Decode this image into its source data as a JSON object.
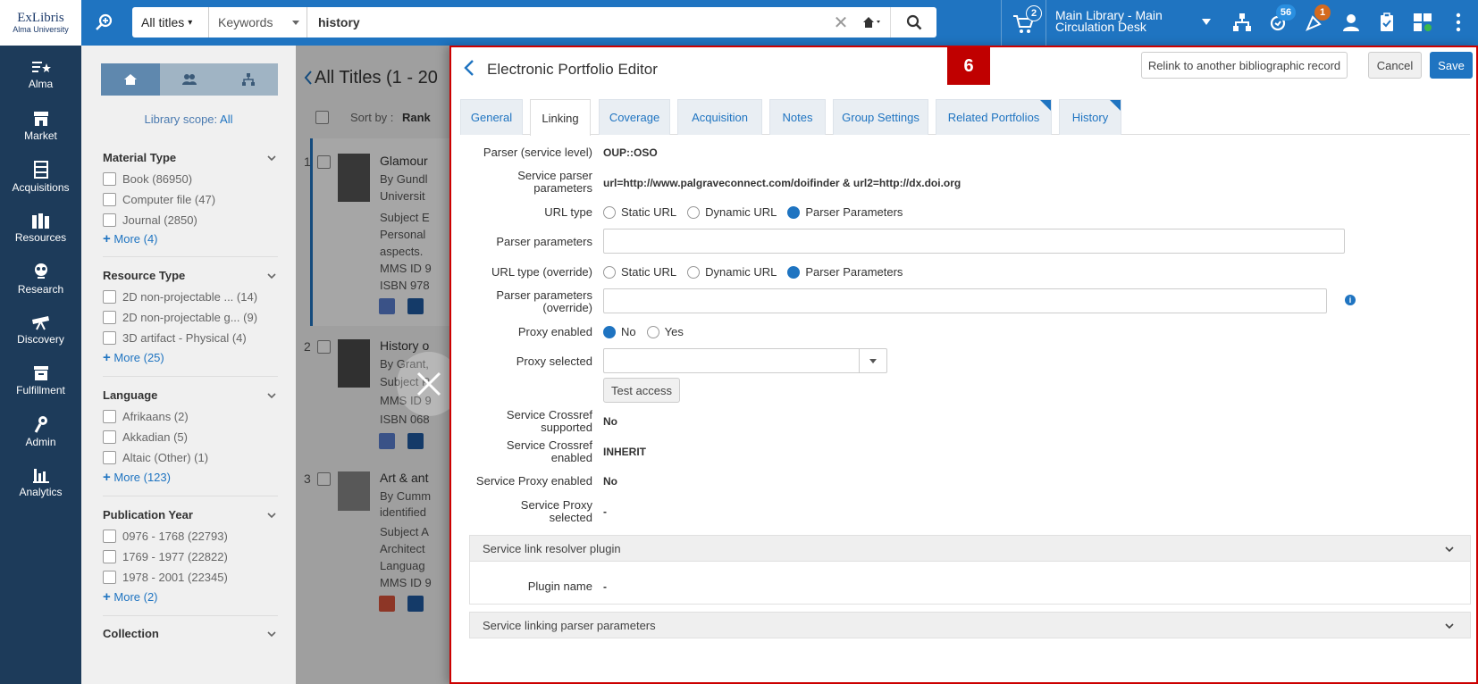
{
  "topbar": {
    "logo_main": "ExLibris",
    "logo_sub": "Alma University",
    "search_scope": "All titles",
    "search_field": "Keywords",
    "search_query": "history",
    "library": "Main Library - Main Circulation Desk",
    "library_line1": "Main Library - Main",
    "library_line2": "Circulation Desk",
    "cart_count": "2",
    "tasks_count": "56",
    "alerts_count": "1"
  },
  "nav": [
    {
      "label": "Alma",
      "icon": "alma-star-icon"
    },
    {
      "label": "Market",
      "icon": "market-icon"
    },
    {
      "label": "Acquisitions",
      "icon": "acquisitions-icon"
    },
    {
      "label": "Resources",
      "icon": "resources-icon"
    },
    {
      "label": "Research",
      "icon": "research-icon"
    },
    {
      "label": "Discovery",
      "icon": "discovery-icon"
    },
    {
      "label": "Fulfillment",
      "icon": "fulfillment-icon"
    },
    {
      "label": "Admin",
      "icon": "admin-icon"
    },
    {
      "label": "Analytics",
      "icon": "analytics-icon"
    }
  ],
  "facets": {
    "scope_label": "Library scope:",
    "scope_value": "All",
    "groups": [
      {
        "title": "Material Type",
        "items": [
          "Book (86950)",
          "Computer file (47)",
          "Journal (2850)"
        ],
        "more": "More (4)"
      },
      {
        "title": "Resource Type",
        "items": [
          "2D non-projectable ... (14)",
          "2D non-projectable g... (9)",
          "3D artifact - Physical (4)"
        ],
        "more": "More (25)"
      },
      {
        "title": "Language",
        "items": [
          "Afrikaans (2)",
          "Akkadian (5)",
          "Altaic (Other) (1)"
        ],
        "more": "More (123)"
      },
      {
        "title": "Publication Year",
        "items": [
          "0976 - 1768 (22793)",
          "1769 - 1977 (22822)",
          "1978 - 2001 (22345)"
        ],
        "more": "More (2)"
      },
      {
        "title": "Collection",
        "items": [],
        "more": ""
      }
    ]
  },
  "results": {
    "title": "All Titles (1 - 20",
    "sort_label": "Sort by :",
    "sort_value": "Rank",
    "rows": [
      {
        "num": "1",
        "lines": [
          "Glamour",
          "By Gundl",
          "Universit",
          "Subject E",
          "Personal",
          "aspects.",
          "MMS ID 9",
          "ISBN 978"
        ]
      },
      {
        "num": "2",
        "lines": [
          "History o",
          "By Grant,",
          "Subject R",
          "MMS ID 9",
          "ISBN 068"
        ]
      },
      {
        "num": "3",
        "lines": [
          "Art & ant",
          "By Cumm",
          "identified",
          "Subject A",
          "Architect",
          "Languag",
          "MMS ID 9"
        ]
      }
    ]
  },
  "editor": {
    "title": "Electronic Portfolio Editor",
    "step": "6",
    "relink_label": "Relink to another bibliographic record",
    "cancel_label": "Cancel",
    "save_label": "Save",
    "tabs": [
      "General",
      "Linking",
      "Coverage",
      "Acquisition",
      "Notes",
      "Group Settings",
      "Related Portfolios",
      "History"
    ],
    "active_tab": "Linking",
    "fields": {
      "parser_service_level_label": "Parser (service level)",
      "parser_service_level": "OUP::OSO",
      "service_parser_params_label": "Service parser parameters",
      "service_parser_params": "url=http://www.palgraveconnect.com/doifinder & url2=http://dx.doi.org",
      "url_type_label": "URL type",
      "url_type_options": [
        "Static URL",
        "Dynamic URL",
        "Parser Parameters"
      ],
      "url_type_selected": "Parser Parameters",
      "parser_params_label": "Parser parameters",
      "parser_params_value": "",
      "url_type_override_label": "URL type (override)",
      "url_type_override_selected": "Parser Parameters",
      "parser_params_override_label": "Parser parameters (override)",
      "parser_params_override_value": "",
      "proxy_enabled_label": "Proxy enabled",
      "proxy_enabled_options": [
        "No",
        "Yes"
      ],
      "proxy_enabled_selected": "No",
      "proxy_selected_label": "Proxy selected",
      "proxy_selected_value": "",
      "test_access_label": "Test access",
      "crossref_supported_label": "Service Crossref supported",
      "crossref_supported": "No",
      "crossref_enabled_label": "Service Crossref enabled",
      "crossref_enabled": "INHERIT",
      "service_proxy_enabled_label": "Service Proxy enabled",
      "service_proxy_enabled": "No",
      "service_proxy_selected_label": "Service Proxy selected",
      "service_proxy_selected": "-"
    },
    "sections": {
      "link_resolver_title": "Service link resolver plugin",
      "plugin_name_label": "Plugin name",
      "plugin_name": "-",
      "linking_parser_title": "Service linking parser parameters"
    }
  },
  "colors": {
    "brand": "#1f74c1",
    "nav_bg": "#1d3b5a",
    "step_badge": "#c00000"
  }
}
